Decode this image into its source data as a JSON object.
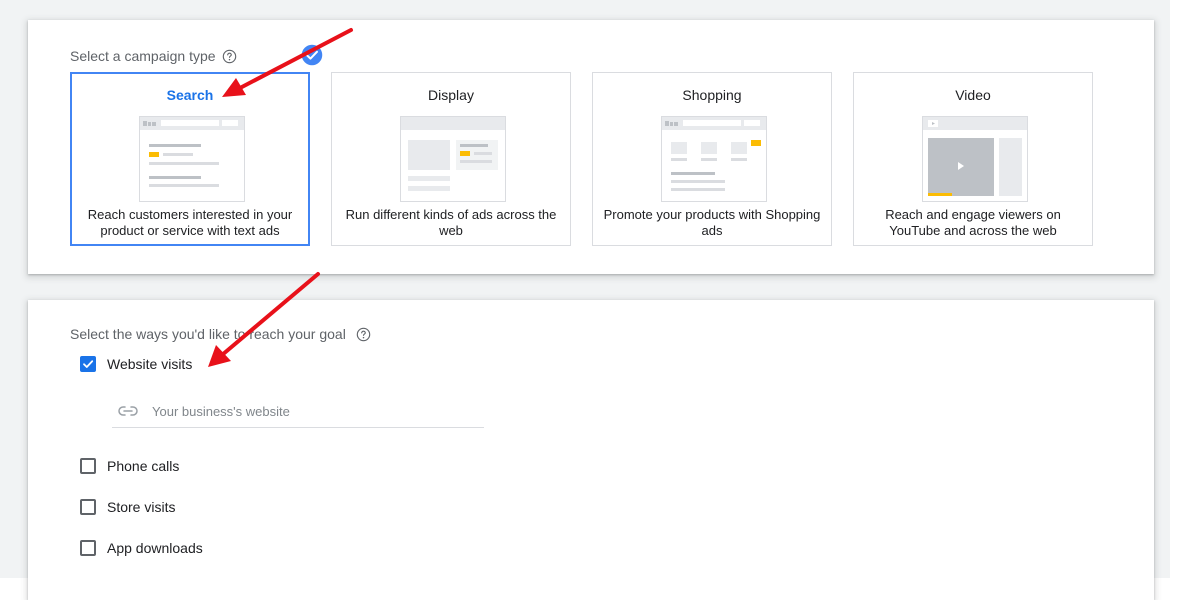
{
  "campaign_type": {
    "title": "Select a campaign type",
    "options": [
      {
        "label": "Search",
        "description": "Reach customers interested in your product or service with text ads",
        "selected": true
      },
      {
        "label": "Display",
        "description": "Run different kinds of ads across the web",
        "selected": false
      },
      {
        "label": "Shopping",
        "description": "Promote your products with Shopping ads",
        "selected": false
      },
      {
        "label": "Video",
        "description": "Reach and engage viewers on YouTube and across the web",
        "selected": false
      }
    ]
  },
  "goals": {
    "title": "Select the ways you'd like to reach your goal",
    "options": [
      {
        "label": "Website visits",
        "checked": true
      },
      {
        "label": "Phone calls",
        "checked": false
      },
      {
        "label": "Store visits",
        "checked": false
      },
      {
        "label": "App downloads",
        "checked": false
      }
    ],
    "website_placeholder": "Your business's website"
  },
  "colors": {
    "accent": "#1a73e8",
    "selected_border": "#4285f4",
    "annotation_arrow": "#e8111a",
    "highlight": "#fbbc04"
  },
  "icons": {
    "help": "help-circle-icon",
    "check_badge": "check-circle-icon",
    "link": "link-icon",
    "checkbox_check": "check-icon"
  }
}
